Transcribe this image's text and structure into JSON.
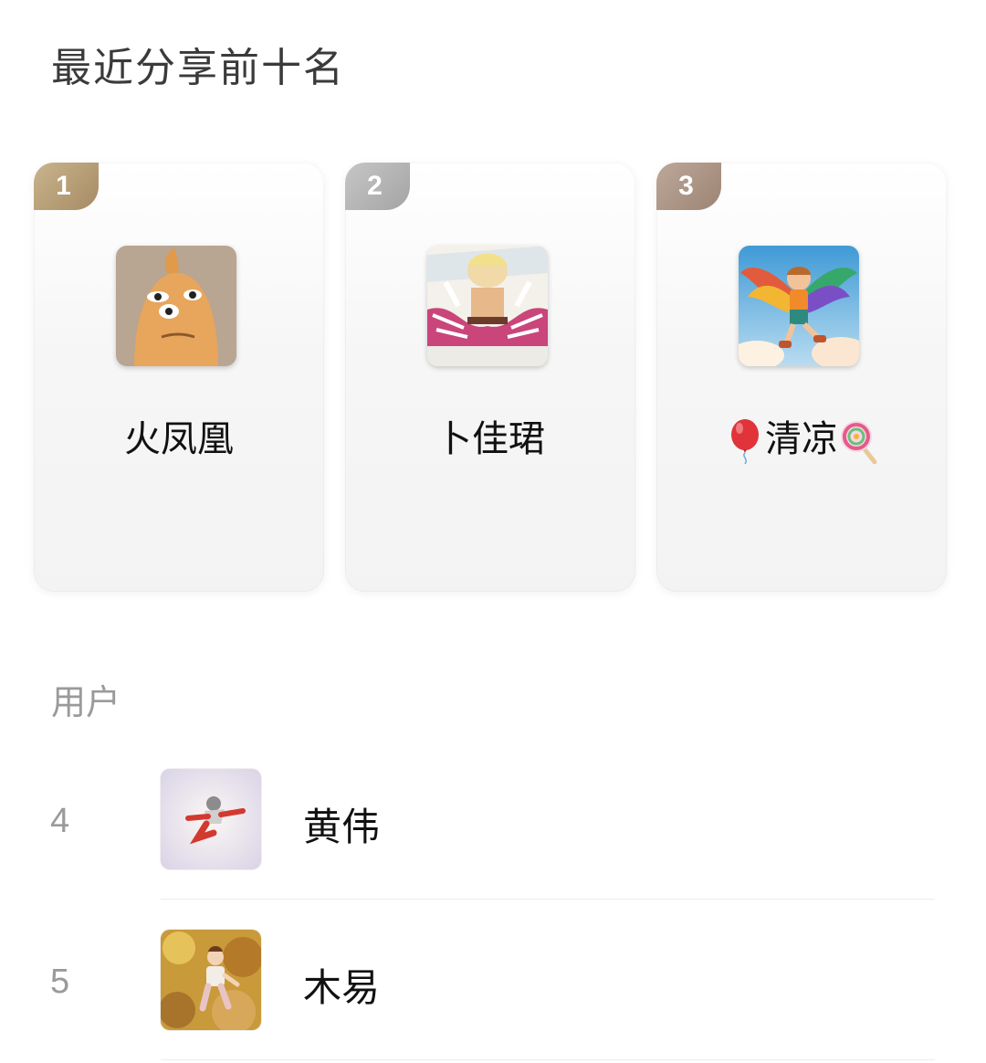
{
  "page": {
    "title": "最近分享前十名"
  },
  "podium": [
    {
      "rank": "1",
      "name": "火凤凰",
      "badge_color": "#b59d76",
      "avatar_icon": "orange-blob-avatar"
    },
    {
      "rank": "2",
      "name": "卜佳珺",
      "badge_color": "#b5b5b5",
      "avatar_icon": "anime-character-avatar"
    },
    {
      "rank": "3",
      "name_prefix_emoji": "balloon-icon",
      "name": "清凉",
      "name_suffix_emoji": "lollipop-icon",
      "badge_color": "#ad9688",
      "avatar_icon": "winged-boy-avatar"
    }
  ],
  "users_section": {
    "label": "用户"
  },
  "users": [
    {
      "rank": "4",
      "name": "黄伟",
      "avatar_icon": "flying-figure-avatar"
    },
    {
      "rank": "5",
      "name": "木易",
      "avatar_icon": "child-autumn-avatar"
    }
  ]
}
